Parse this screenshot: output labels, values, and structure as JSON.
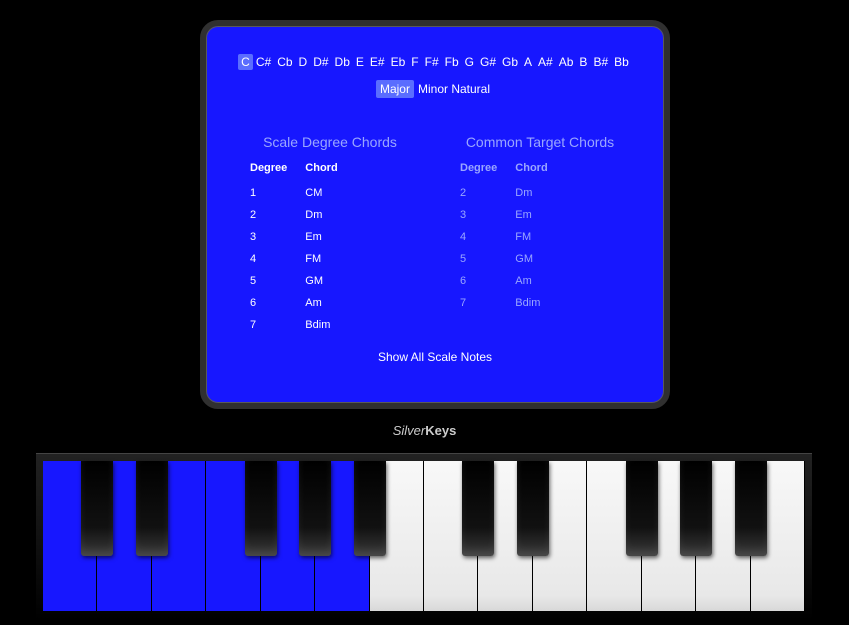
{
  "notes": [
    "C",
    "C#",
    "Cb",
    "D",
    "D#",
    "Db",
    "E",
    "E#",
    "Eb",
    "F",
    "F#",
    "Fb",
    "G",
    "G#",
    "Gb",
    "A",
    "A#",
    "Ab",
    "B",
    "B#",
    "Bb"
  ],
  "selected_note_index": 0,
  "modes": [
    "Major",
    "Minor Natural"
  ],
  "selected_mode_index": 0,
  "scale_title": "Scale Degree Chords",
  "common_title": "Common Target Chords",
  "col_degree": "Degree",
  "col_chord": "Chord",
  "scale_chords": [
    {
      "degree": "1",
      "chord": "CM"
    },
    {
      "degree": "2",
      "chord": "Dm"
    },
    {
      "degree": "3",
      "chord": "Em"
    },
    {
      "degree": "4",
      "chord": "FM"
    },
    {
      "degree": "5",
      "chord": "GM"
    },
    {
      "degree": "6",
      "chord": "Am"
    },
    {
      "degree": "7",
      "chord": "Bdim"
    }
  ],
  "common_chords": [
    {
      "degree": "2",
      "chord": "Dm"
    },
    {
      "degree": "3",
      "chord": "Em"
    },
    {
      "degree": "4",
      "chord": "FM"
    },
    {
      "degree": "5",
      "chord": "GM"
    },
    {
      "degree": "6",
      "chord": "Am"
    },
    {
      "degree": "7",
      "chord": "Bdim"
    }
  ],
  "show_all_label": "Show All Scale Notes",
  "brand_prefix": "Silver",
  "brand_suffix": "Keys",
  "keyboard": {
    "white_keys": 14,
    "highlighted_white": [
      0,
      1,
      2,
      3,
      4,
      5
    ],
    "black_after_white": [
      0,
      1,
      3,
      4,
      5,
      7,
      8,
      10,
      11,
      12
    ]
  }
}
